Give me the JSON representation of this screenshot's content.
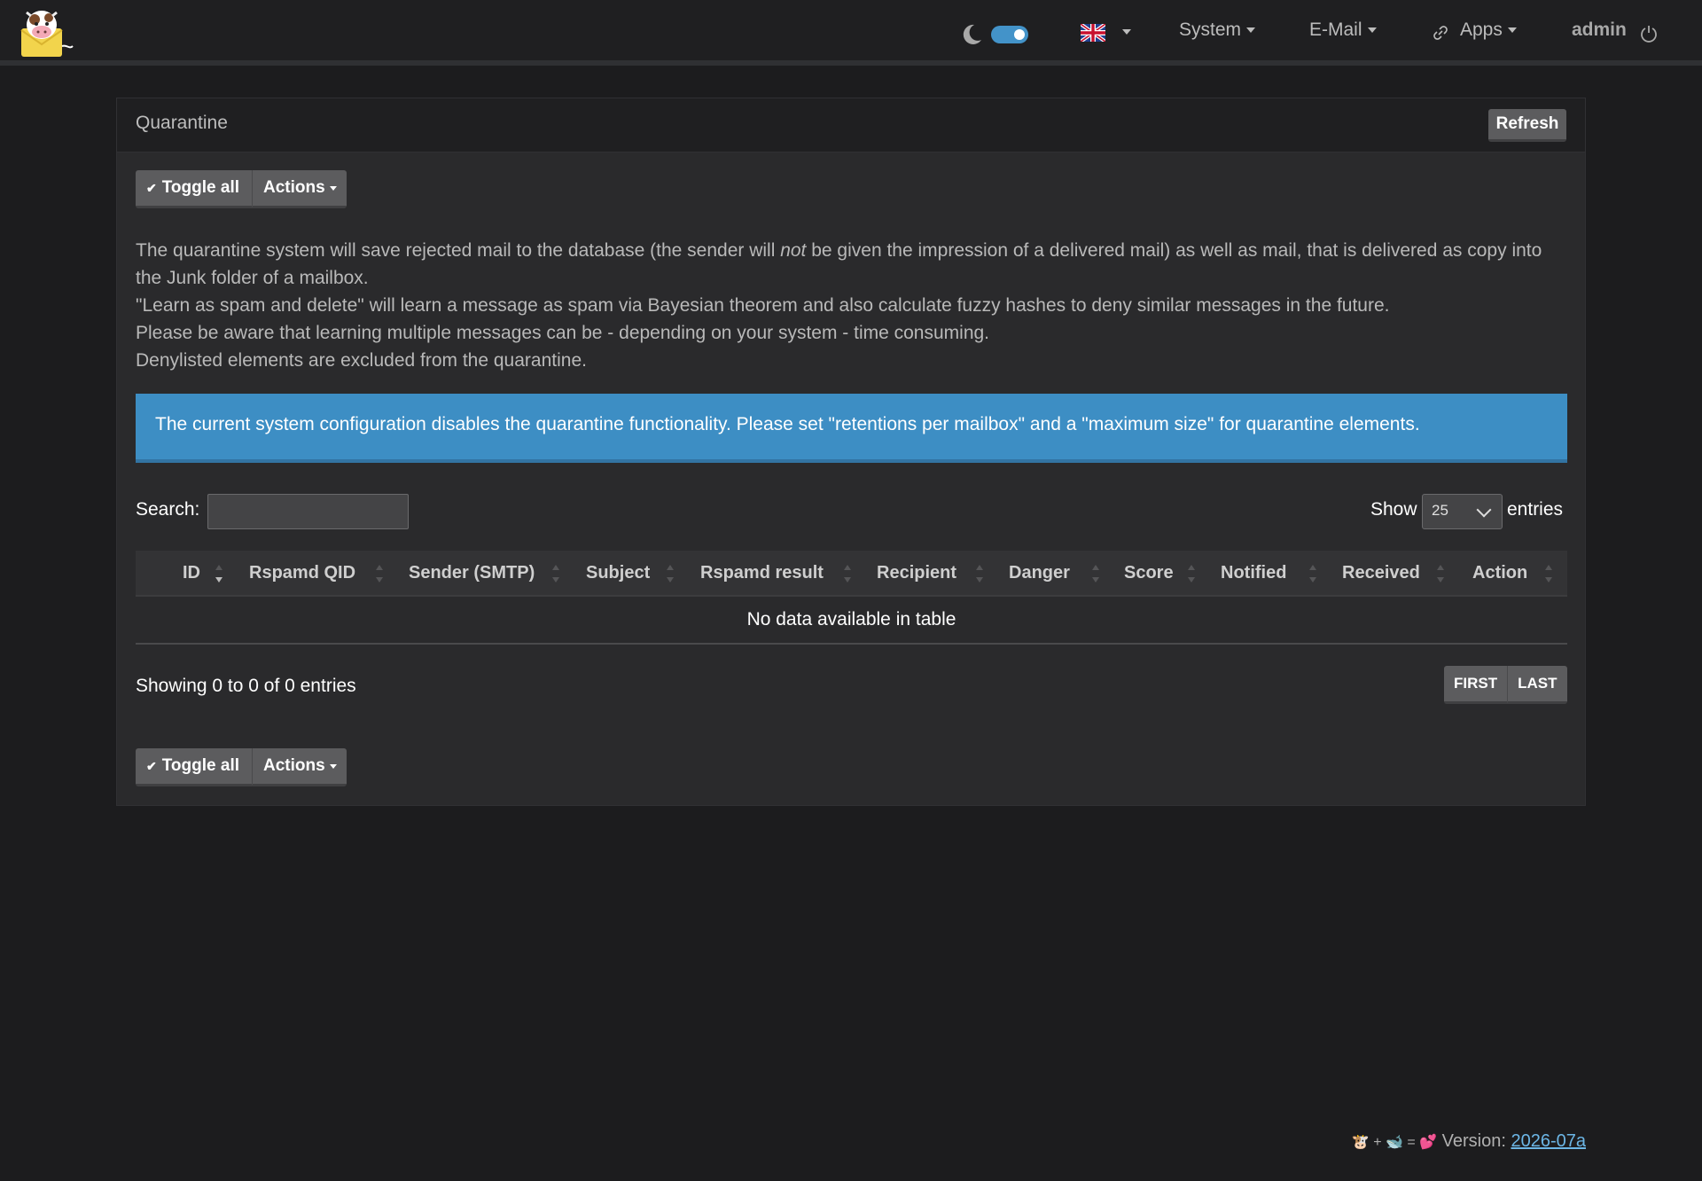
{
  "navbar": {
    "system_label": "System",
    "email_label": "E-Mail",
    "apps_label": "Apps",
    "admin_label": "admin"
  },
  "panel": {
    "title": "Quarantine",
    "refresh_label": "Refresh"
  },
  "toolbar": {
    "toggle_all_label": "Toggle all",
    "actions_label": "Actions"
  },
  "description": {
    "line1_before": "The quarantine system will save rejected mail to the database (the sender will ",
    "line1_em": "not",
    "line1_after": " be given the impression of a delivered mail) as well as mail, that is delivered as copy into the Junk folder of a mailbox.",
    "line2": "\"Learn as spam and delete\" will learn a message as spam via Bayesian theorem and also calculate fuzzy hashes to deny similar messages in the future.",
    "line3": "Please be aware that learning multiple messages can be - depending on your system - time consuming.",
    "line4": "Denylisted elements are excluded from the quarantine."
  },
  "alert": {
    "text": "The current system configuration disables the quarantine functionality. Please set \"retentions per mailbox\" and a \"maximum size\" for quarantine elements."
  },
  "table_controls": {
    "search_label": "Search:",
    "search_value": "",
    "show_label": "Show",
    "page_size": "25",
    "entries_label": "entries"
  },
  "table": {
    "columns": [
      "ID",
      "Rspamd QID",
      "Sender (SMTP)",
      "Subject",
      "Rspamd result",
      "Recipient",
      "Danger",
      "Score",
      "Notified",
      "Received",
      "Action"
    ],
    "empty_text": "No data available in table",
    "sorted_column": "ID",
    "sort_direction": "desc"
  },
  "pagination": {
    "showing_text": "Showing 0 to 0 of 0 entries",
    "first_label": "FIRST",
    "last_label": "LAST"
  },
  "footer": {
    "emoji_left": "🐮 + 🐋 = 💕",
    "version_label": "Version:",
    "version_value": "2026-07a"
  },
  "colors": {
    "background": "#1c1c1e",
    "panel": "#2a2a2c",
    "alert": "#3d8ec4",
    "toggle": "#4393c9",
    "button": "#5c5c5e",
    "link": "#6cb6e6"
  },
  "icons": {
    "logo": "cow-mail-logo",
    "theme": "moon-icon",
    "language": "uk-flag-icon",
    "apps": "link-icon",
    "logout": "power-icon"
  }
}
